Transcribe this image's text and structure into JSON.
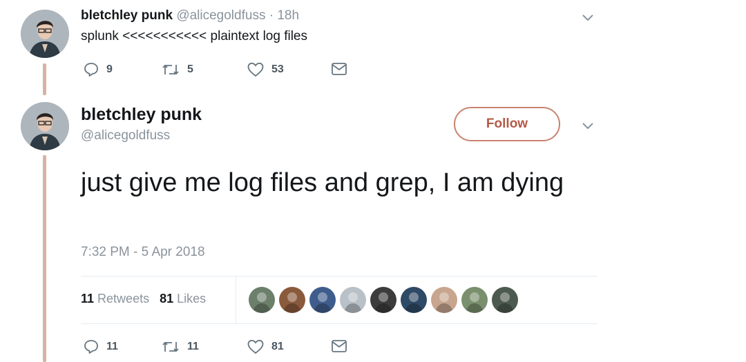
{
  "tweet1": {
    "name": "bletchley punk",
    "handle": "@alicegoldfuss",
    "separator": "·",
    "time": "18h",
    "text": "splunk <<<<<<<<<<< plaintext log files",
    "replies": "9",
    "retweets": "5",
    "likes": "53"
  },
  "tweet2": {
    "name": "bletchley punk",
    "handle": "@alicegoldfuss",
    "follow_label": "Follow",
    "text": "just give me log files and grep, I am dying",
    "timestamp": "7:32 PM - 5 Apr 2018",
    "stats": {
      "retweets_count": "11",
      "retweets_label": "Retweets",
      "likes_count": "81",
      "likes_label": "Likes"
    },
    "replies": "11",
    "retweets": "11",
    "likes": "81"
  },
  "liker_colors": [
    "#6b7f6a",
    "#8a5a3c",
    "#3f5d8c",
    "#b9c1c8",
    "#3c3c3c",
    "#2f4a66",
    "#c7a58e",
    "#7a8f6e",
    "#4d5a4f"
  ],
  "colors": {
    "thread_line": "#d8b3a3",
    "follow_accent": "#b35a46",
    "muted_text": "#8a939c"
  },
  "icons": [
    "reply-icon",
    "retweet-icon",
    "like-icon",
    "direct-message-icon",
    "chevron-down-icon"
  ]
}
